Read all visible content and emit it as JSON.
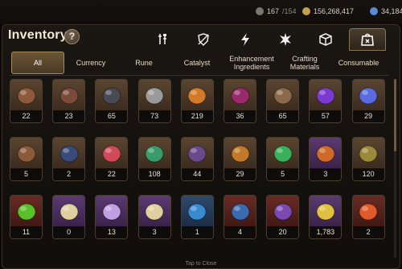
{
  "header": {
    "resources": [
      {
        "icon": "stamina-icon",
        "current": "167",
        "max": "/154"
      },
      {
        "icon": "gold-icon",
        "current": "156,268,417",
        "max": ""
      },
      {
        "icon": "gem-icon",
        "current": "34,184",
        "max": ""
      }
    ]
  },
  "inventory": {
    "title": "Inventory",
    "help_label": "?",
    "category_tabs": [
      {
        "icon": "equipment-icon"
      },
      {
        "icon": "shield-icon"
      },
      {
        "icon": "lightning-icon"
      },
      {
        "icon": "spark-icon"
      },
      {
        "icon": "box-icon"
      },
      {
        "icon": "bag-icon",
        "active": true
      }
    ],
    "subtabs": [
      {
        "label": "All",
        "active": true
      },
      {
        "label": "Currency"
      },
      {
        "label": "Rune"
      },
      {
        "label": "Catalyst"
      },
      {
        "label": "Enhancement\nIngredients"
      },
      {
        "label": "Crafting\nMaterials"
      },
      {
        "label": "Consumable"
      }
    ],
    "items": [
      {
        "icon": "book-icon",
        "qty": "22",
        "color": "#8a5a3a",
        "bg": "g-brown"
      },
      {
        "icon": "ore-icon",
        "qty": "23",
        "color": "#7a4a3a",
        "bg": "g-brown"
      },
      {
        "icon": "cloak-icon",
        "qty": "65",
        "color": "#4a4a55",
        "bg": "g-brown"
      },
      {
        "icon": "dagger-icon",
        "qty": "73",
        "color": "#9a9a9a",
        "bg": "g-brown"
      },
      {
        "icon": "coin-icon",
        "qty": "219",
        "color": "#d07a2a",
        "bg": "g-brown"
      },
      {
        "icon": "orb-icon",
        "qty": "36",
        "color": "#9a2a6a",
        "bg": "g-brown"
      },
      {
        "icon": "leather-icon",
        "qty": "65",
        "color": "#8a6a4a",
        "bg": "g-brown"
      },
      {
        "icon": "crystal-orb-icon",
        "qty": "57",
        "color": "#7a3ad0",
        "bg": "g-brown"
      },
      {
        "icon": "gem-stone-icon",
        "qty": "29",
        "color": "#5a6ae0",
        "bg": "g-brown"
      },
      {
        "icon": "fang-icon",
        "qty": "5",
        "color": "#8a5a3a",
        "bg": "g-brown"
      },
      {
        "icon": "dark-amulet-icon",
        "qty": "2",
        "color": "#3a4a7a",
        "bg": "g-brown"
      },
      {
        "icon": "red-gem-icon",
        "qty": "22",
        "color": "#d04a5a",
        "bg": "g-brown"
      },
      {
        "icon": "green-amulet-icon",
        "qty": "108",
        "color": "#3a9a6a",
        "bg": "g-brown"
      },
      {
        "icon": "purple-scale-icon",
        "qty": "44",
        "color": "#6a4a8a",
        "bg": "g-brown"
      },
      {
        "icon": "mask-icon",
        "qty": "29",
        "color": "#c07a2a",
        "bg": "g-brown"
      },
      {
        "icon": "elemental-orbs-icon",
        "qty": "5",
        "color": "#3ab05a",
        "bg": "g-brown"
      },
      {
        "icon": "feather-icon",
        "qty": "3",
        "color": "#d06a2a",
        "bg": "g-purple"
      },
      {
        "icon": "claw-icon",
        "qty": "120",
        "color": "#9a8a3a",
        "bg": "g-brown"
      },
      {
        "icon": "green-potion-icon",
        "qty": "11",
        "color": "#5ac02a",
        "bg": "g-red"
      },
      {
        "icon": "tarot-card-icon",
        "qty": "0",
        "color": "#e0d0a0",
        "bg": "g-purple"
      },
      {
        "icon": "magic-staff-icon",
        "qty": "13",
        "color": "#c0a0e0",
        "bg": "g-purple"
      },
      {
        "icon": "pet-card-icon",
        "qty": "3",
        "color": "#e0d0a0",
        "bg": "g-purple"
      },
      {
        "icon": "blue-charm-icon",
        "qty": "1",
        "color": "#3a8ad0",
        "bg": "g-blue"
      },
      {
        "icon": "blue-charm-icon",
        "qty": "4",
        "color": "#3a6ab0",
        "bg": "g-red"
      },
      {
        "icon": "purple-charm-icon",
        "qty": "20",
        "color": "#7a4ab0",
        "bg": "g-red"
      },
      {
        "icon": "eye-emblem-icon",
        "qty": "1,783",
        "color": "#e0c040",
        "bg": "g-purple"
      },
      {
        "icon": "fire-charm-icon",
        "qty": "2",
        "color": "#e05a2a",
        "bg": "g-red"
      }
    ],
    "footer_hint": "Tap to Close"
  }
}
